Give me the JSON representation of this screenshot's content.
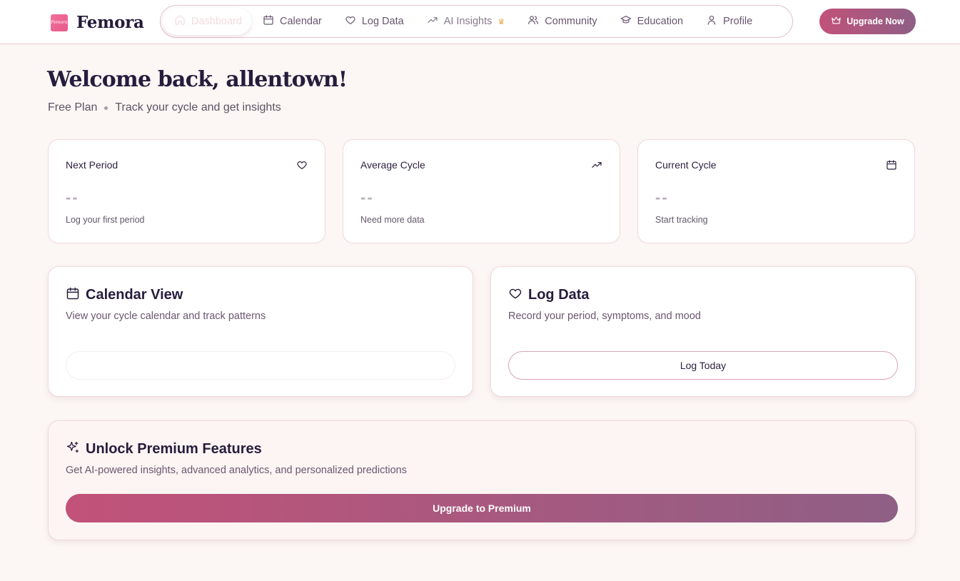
{
  "app": {
    "logo_mark": "Femora",
    "name": "Femora"
  },
  "nav": {
    "items": [
      {
        "label": "Dashboard",
        "icon": "home-icon",
        "active": true
      },
      {
        "label": "Calendar",
        "icon": "calendar-icon"
      },
      {
        "label": "Log Data",
        "icon": "heart-icon"
      },
      {
        "label": "AI Insights",
        "icon": "trending-up-icon",
        "badge_icon": "crown-icon"
      },
      {
        "label": "Community",
        "icon": "users-icon"
      },
      {
        "label": "Education",
        "icon": "graduation-cap-icon"
      },
      {
        "label": "Profile",
        "icon": "user-icon"
      }
    ],
    "upgrade_label": "Upgrade Now"
  },
  "welcome": {
    "title": "Welcome back, allentown!",
    "plan": "Free Plan",
    "subtitle": "Track your cycle and get insights"
  },
  "stats": [
    {
      "title": "Next Period",
      "icon": "heart-icon",
      "value": "--",
      "caption": "Log your first period"
    },
    {
      "title": "Average Cycle",
      "icon": "trending-up-icon",
      "value": "--",
      "caption": "Need more data"
    },
    {
      "title": "Current Cycle",
      "icon": "calendar-icon",
      "value": "--",
      "caption": "Start tracking"
    }
  ],
  "calendar_card": {
    "title": "Calendar View",
    "description": "View your cycle calendar and track patterns",
    "icon": "calendar-icon"
  },
  "log_card": {
    "title": "Log Data",
    "description": "Record your period, symptoms, and mood",
    "icon": "heart-icon",
    "button_label": "Log Today"
  },
  "premium": {
    "title": "Unlock Premium Features",
    "description": "Get AI-powered insights, advanced analytics, and personalized predictions",
    "icon": "sparkles-icon",
    "button_label": "Upgrade to Premium"
  },
  "colors": {
    "background": "#fcf6f4",
    "accent_start": "#c25279",
    "accent_end": "#8f5f85",
    "text_dark": "#261c3d"
  }
}
